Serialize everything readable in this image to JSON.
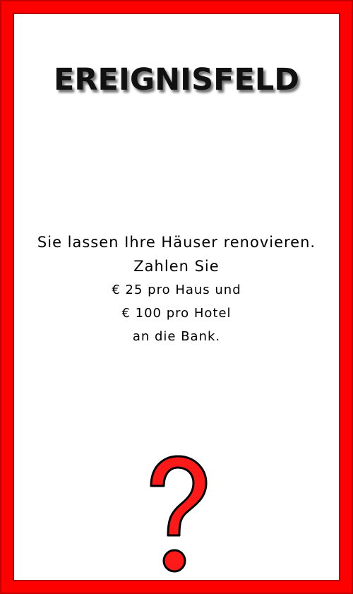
{
  "card": {
    "title": "EREIGNISFELD",
    "lines": [
      "Sie lassen Ihre Häuser renovieren.",
      "Zahlen Sie",
      "€ 25 pro Haus und",
      "€ 100 pro Hotel",
      "an die Bank."
    ],
    "icon": "question-mark-icon",
    "colors": {
      "border": "#ff0000",
      "icon_fill": "#ff1a1a",
      "text": "#000000"
    }
  }
}
